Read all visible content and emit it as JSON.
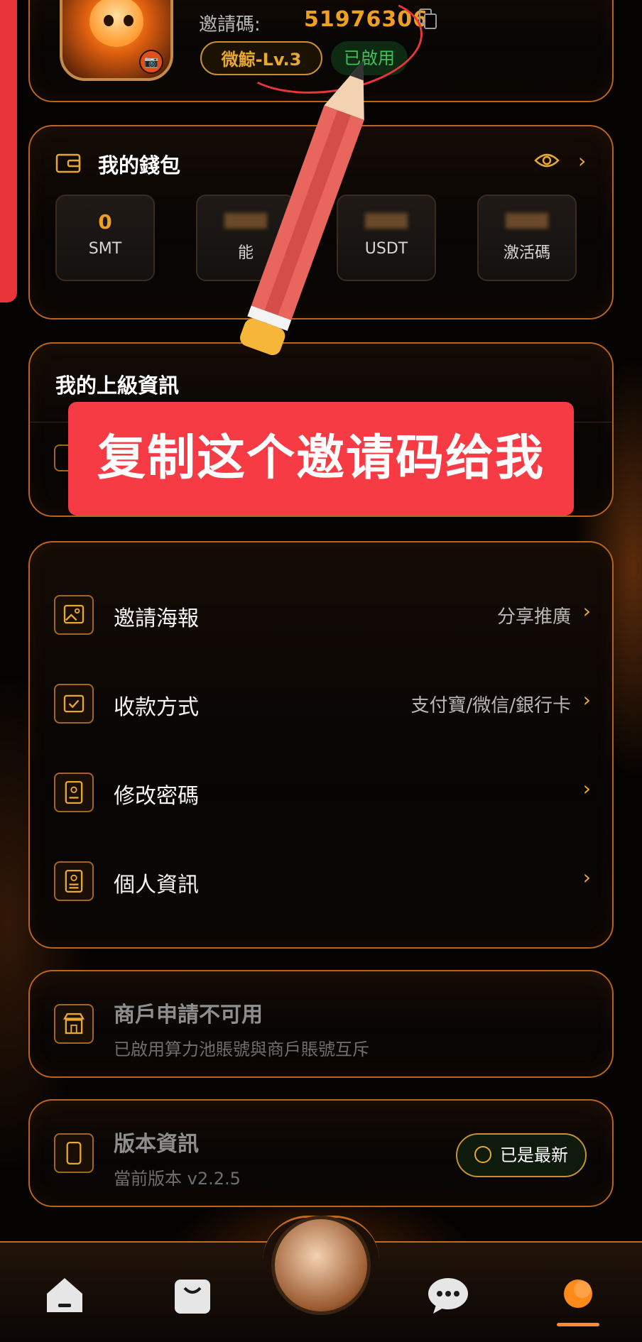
{
  "profile": {
    "invite_label": "邀請碼:",
    "invite_code": "51976306",
    "level": "微鯨-Lv.3",
    "status": "已啟用"
  },
  "wallet": {
    "title": "我的錢包",
    "assets": [
      {
        "value": "0",
        "name": "SMT"
      },
      {
        "value": "",
        "name": "能"
      },
      {
        "value": "",
        "name": "USDT"
      },
      {
        "value": "",
        "name": "激活碼"
      }
    ]
  },
  "superior": {
    "title": "我的上級資訊"
  },
  "menu": [
    {
      "label": "邀請海報",
      "value": "分享推廣"
    },
    {
      "label": "收款方式",
      "value": "支付寶/微信/銀行卡"
    },
    {
      "label": "修改密碼",
      "value": ""
    },
    {
      "label": "個人資訊",
      "value": ""
    }
  ],
  "merchant": {
    "title": "商戶申請不可用",
    "desc": "已啟用算力池賬號與商戶賬號互斥"
  },
  "version": {
    "title": "版本資訊",
    "desc": "當前版本 v2.2.5",
    "button": "已是最新"
  },
  "overlay": {
    "banner": "复制这个邀请码给我"
  },
  "icons": {
    "chevron": "›"
  },
  "colors": {
    "accent": "#f0a020",
    "border": "#b8641f",
    "banner": "#f63b44",
    "status_green": "#3fc25a"
  }
}
